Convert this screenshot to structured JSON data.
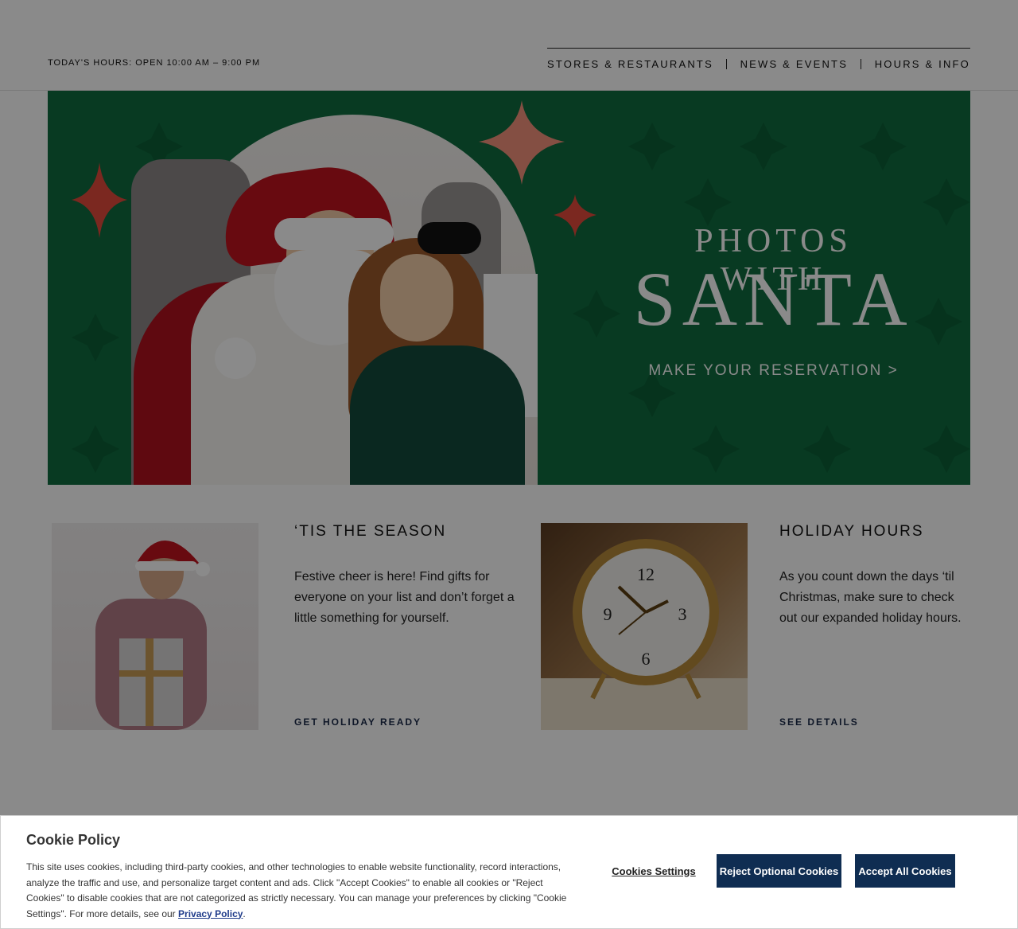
{
  "header": {
    "hours_text": "TODAY'S HOURS: OPEN 10:00 AM – 9:00 PM",
    "nav": [
      "STORES & RESTAURANTS",
      "NEWS & EVENTS",
      "HOURS & INFO"
    ]
  },
  "hero": {
    "line1": "PHOTOS WITH",
    "line2": "SANTA",
    "cta": "MAKE YOUR RESERVATION >",
    "colors": {
      "background": "#0f6b3f",
      "sparkle": "#e44b3b",
      "sparkle_light": "#f4927c"
    }
  },
  "cards": [
    {
      "title": "‘TIS THE SEASON",
      "text": "Festive cheer is here! Find gifts for everyone on your list and don’t forget a little something for yourself.",
      "link": "GET HOLIDAY READY",
      "image": "man-with-santa-hat-holding-gift"
    },
    {
      "title": "HOLIDAY HOURS",
      "text": "As you count down the days ‘til Christmas, make sure to check out our expanded holiday hours.",
      "link": "SEE DETAILS",
      "image": "alarm-clock"
    }
  ],
  "clock_numerals": [
    "12",
    "3",
    "6",
    "9"
  ],
  "cookie": {
    "title": "Cookie Policy",
    "text": "This site uses cookies, including third-party cookies, and other technologies to enable website functionality, record interactions, analyze the traffic and use, and personalize target content and ads. Click \"Accept Cookies\" to enable all cookies or \"Reject Cookies\" to disable cookies that are not categorized as strictly necessary. You can manage your preferences by clicking \"Cookie Settings\". For more details, see our",
    "privacy_link": "Privacy Policy",
    "settings_button": "Cookies Settings",
    "reject_button": "Reject Optional Cookies",
    "accept_button": "Accept All Cookies",
    "colors": {
      "button": "#0f2d52"
    }
  }
}
